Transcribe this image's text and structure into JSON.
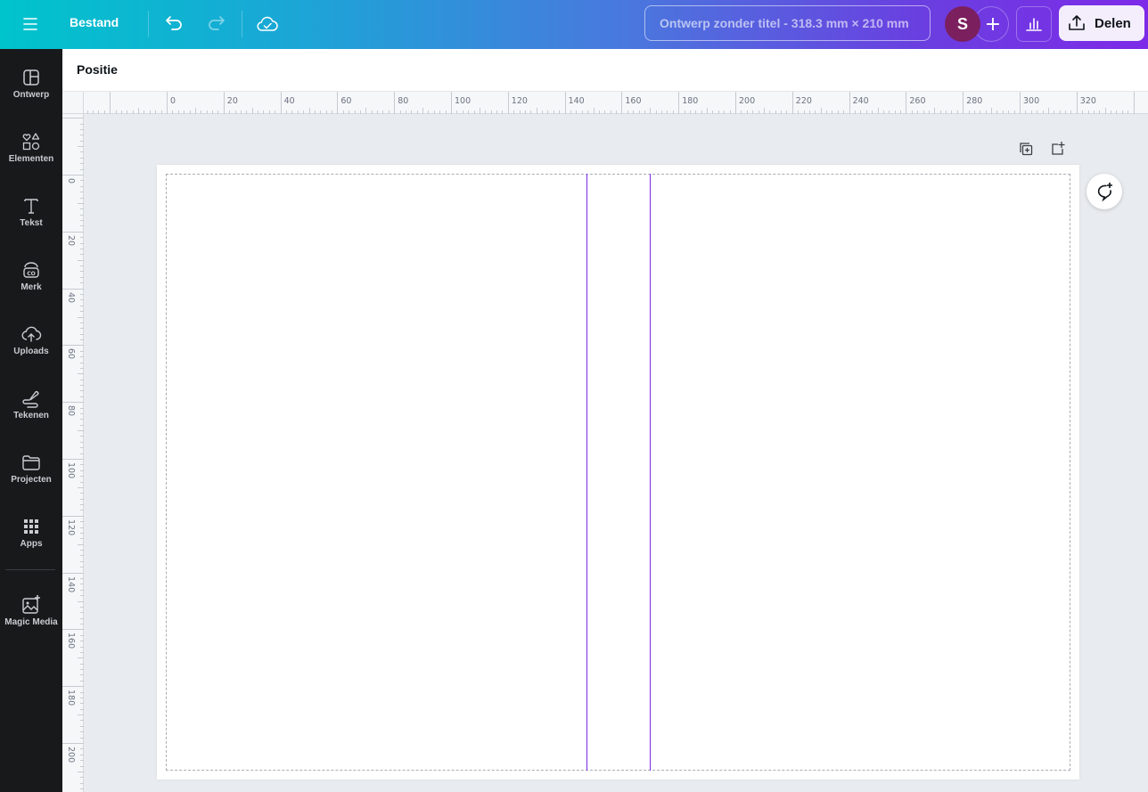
{
  "topbar": {
    "menu_icon": "hamburger-icon",
    "file_label": "Bestand",
    "undo_icon": "undo-icon",
    "redo_icon": "redo-icon",
    "save_status_icon": "cloud-check-icon",
    "document_title_placeholder": "Ontwerp zonder titel - 318.3 mm × 210 mm",
    "avatar_initial": "S",
    "avatar_color": "#7b1f5f",
    "add_label": "+",
    "insights_icon": "bar-chart-icon",
    "share_label": "Delen",
    "share_icon": "upload-icon"
  },
  "sidebar": {
    "items": [
      {
        "label": "Ontwerp",
        "icon": "layout-icon"
      },
      {
        "label": "Elementen",
        "icon": "shapes-icon"
      },
      {
        "label": "Tekst",
        "icon": "text-icon"
      },
      {
        "label": "Merk",
        "icon": "brand-icon"
      },
      {
        "label": "Uploads",
        "icon": "cloud-upload-icon"
      },
      {
        "label": "Tekenen",
        "icon": "draw-icon"
      },
      {
        "label": "Projecten",
        "icon": "folder-icon"
      },
      {
        "label": "Apps",
        "icon": "apps-grid-icon"
      },
      {
        "label": "Magic Media",
        "icon": "magic-media-icon"
      }
    ]
  },
  "panel": {
    "title": "Positie"
  },
  "rulers": {
    "unit": "mm",
    "horizontal_labels": [
      "0",
      "20",
      "40",
      "60",
      "80",
      "100",
      "120",
      "140",
      "160",
      "180",
      "200",
      "220",
      "240",
      "260",
      "280",
      "300",
      "320"
    ],
    "vertical_labels": [
      "0",
      "20",
      "40",
      "60",
      "80",
      "100",
      "120",
      "140",
      "160",
      "180",
      "200"
    ]
  },
  "canvas": {
    "page_width_mm": 318.3,
    "page_height_mm": 210,
    "guides_mm": [
      147.7,
      169.9
    ],
    "guide_color": "#7d2ae8",
    "page_tools": [
      "duplicate-page-icon",
      "add-page-icon"
    ],
    "comment_icon": "add-comment-icon"
  }
}
